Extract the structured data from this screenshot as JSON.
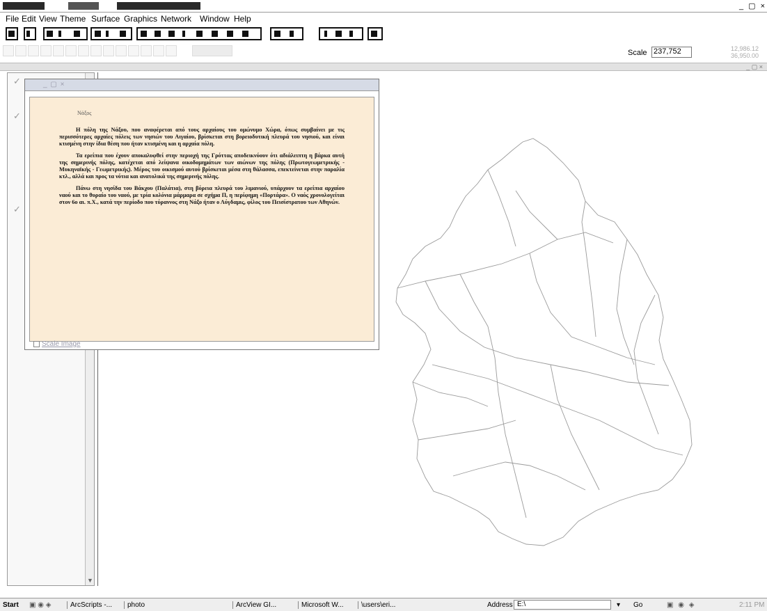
{
  "app": {
    "window_controls": "_ ▢ ×"
  },
  "menu": [
    "File",
    "Edit",
    "View",
    "Theme",
    "Surface",
    "Graphics",
    "Network",
    "Window",
    "Help"
  ],
  "scale": {
    "label": "Scale",
    "value": "237,752",
    "coords": [
      "12,986.12",
      "36,950.00"
    ]
  },
  "text_window": {
    "controls": "_ ▢ ×",
    "heading": "Νάξος",
    "paragraphs": [
      "Η πόλη της Νάξου, που αναφέρεται από τους αρχαίους του ομώνυμο Χώρα, όπως συμβαίνει με τις περισσότερες αρχαίες πόλεις των νησιών του Αιγαίου, βρίσκεται στη βορειοδυτική πλευρά του νησιού, και είναι κτισμένη στην ίδια θέση που ήταν κτισμένη και η αρχαία πόλη.",
      "Τα ερείπια που έχουν αποκαλυφθεί στην περιοχή της Γρόττας αποδεικνύουν ότι αδιάλειπτη η βάρκα αυτή της σημερινής πόλης, κατέχεται από λείψανα οικοδομημάτων των αιώνων της πόλης (Πρωτογεωμετρικής - Μυκηναϊκής - Γεωμετρικής). Μέρος του οικισμού αυτού βρίσκεται μέσα στη θάλασσα, επεκτείνεται στην παραλία κτλ., αλλά και προς τα νότια και ανατολικά της σημερινής πόλης.",
      "Πάνω στη νησίδα του Βάκχου (Παλάτια), στη βόρεια πλευρά του λιμανιού, υπάρχουν τα ερείπια αρχαίου ναού και το θυραίο του ναού, με τρία κολόνια μάρμαρα σε σχήμα Π, η περίφημη «Πορτάρα». Ο ναός χρονολογείται στον 6ο αι. π.Χ., κατά την περίοδο που τύραννος στη Νάξο ήταν ο Λύγδαμις, φίλος του Πεισίστρατου των Αθηνών."
    ],
    "scale_image_label": "Scale Image"
  },
  "taskbar": {
    "start": "Start",
    "tasks": [
      "ArcScripts -...",
      "photo",
      "ArcView GI...",
      "Microsoft W...",
      "\\users\\eri..."
    ],
    "address_label": "Address",
    "address_value": "E:\\",
    "go_label": "Go",
    "tray_icons": "▣ ◉ ◈",
    "clock": "2:11 PM"
  }
}
